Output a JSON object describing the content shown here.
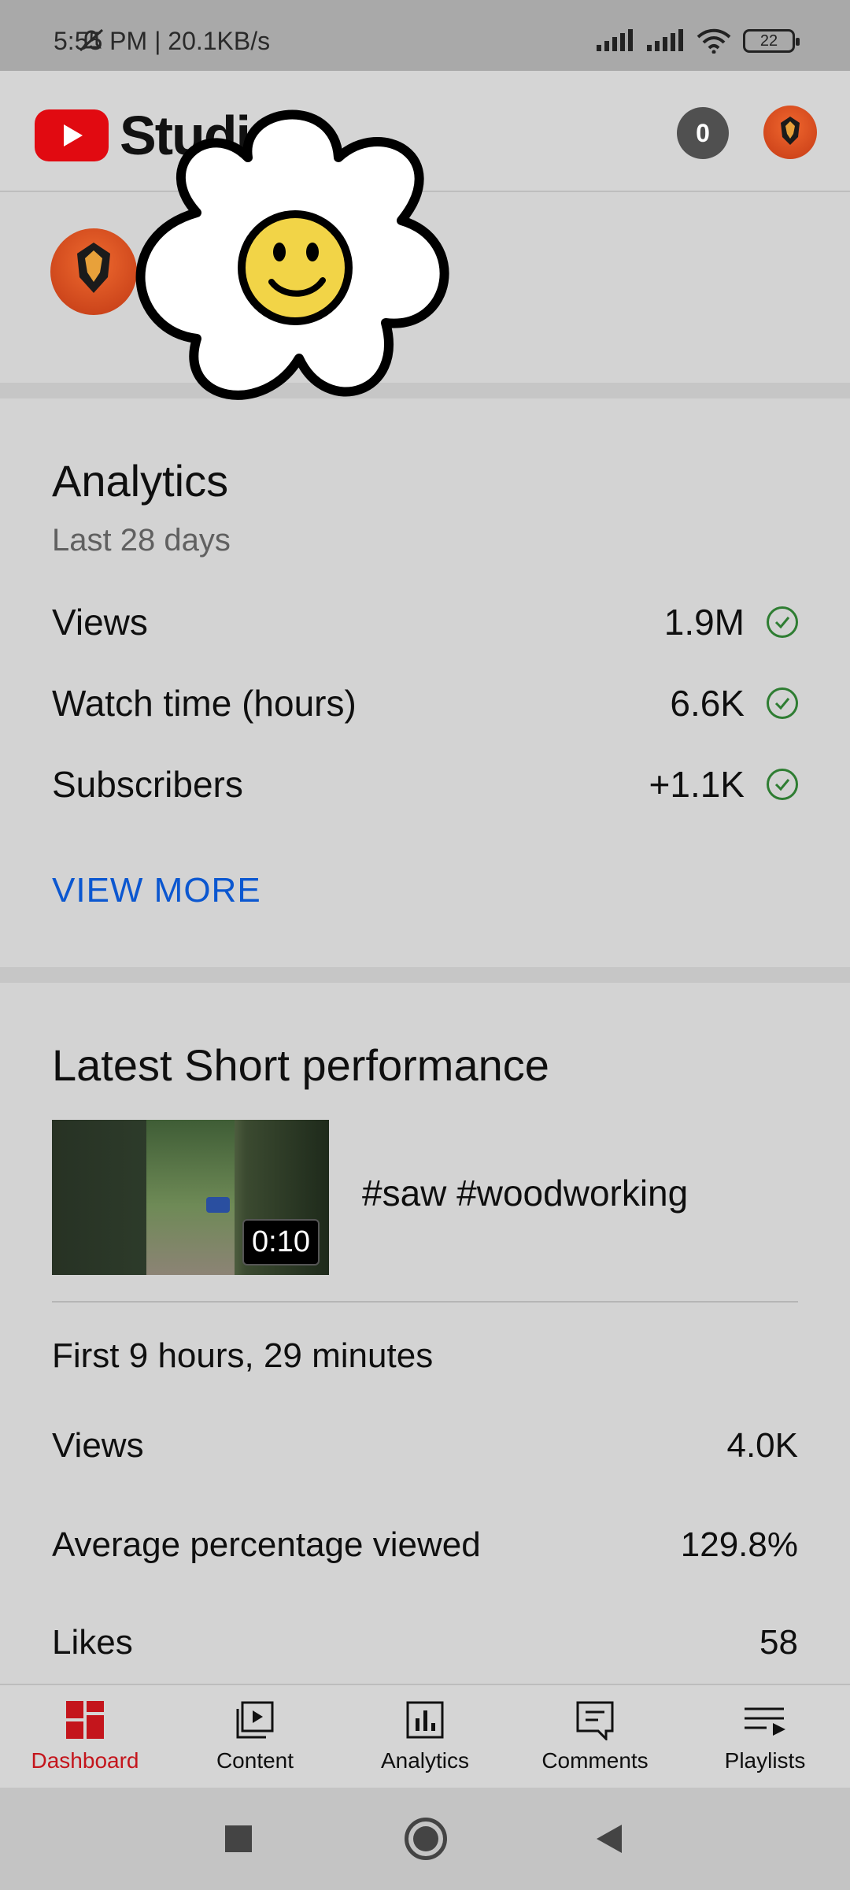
{
  "status_bar": {
    "time_network": "5:55 PM | 20.1KB/s",
    "battery": "22"
  },
  "app_bar": {
    "brand": "Studio",
    "notifications_count": "0"
  },
  "analytics": {
    "title": "Analytics",
    "period": "Last 28 days",
    "rows": [
      {
        "label": "Views",
        "value": "1.9M"
      },
      {
        "label": "Watch time (hours)",
        "value": "6.6K"
      },
      {
        "label": "Subscribers",
        "value": "+1.1K"
      }
    ],
    "view_more": "VIEW MORE"
  },
  "latest_short": {
    "title": "Latest Short performance",
    "short_title": "#saw #woodworking",
    "duration": "0:10",
    "period": "First 9 hours, 29 minutes",
    "rows": [
      {
        "label": "Views",
        "value": "4.0K"
      },
      {
        "label": "Average percentage viewed",
        "value": "129.8%"
      },
      {
        "label": "Likes",
        "value": "58"
      }
    ]
  },
  "bottom_nav": {
    "items": [
      {
        "label": "Dashboard",
        "icon": "dashboard-icon",
        "active": true
      },
      {
        "label": "Content",
        "icon": "content-icon"
      },
      {
        "label": "Analytics",
        "icon": "analytics-icon"
      },
      {
        "label": "Comments",
        "icon": "comments-icon"
      },
      {
        "label": "Playlists",
        "icon": "playlists-icon"
      }
    ]
  },
  "colors": {
    "brand_red": "#e10a11",
    "active_nav": "#c4151c",
    "link_blue": "#0b57d0",
    "check_green": "#2e7d32"
  }
}
